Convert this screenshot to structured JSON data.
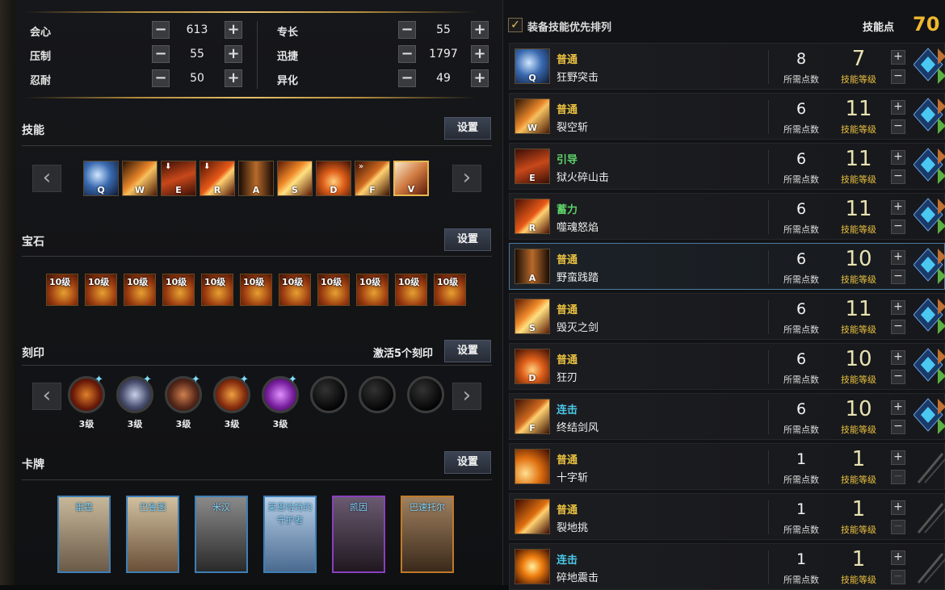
{
  "stats": {
    "left": [
      {
        "label": "会心",
        "value": "613"
      },
      {
        "label": "压制",
        "value": "55"
      },
      {
        "label": "忍耐",
        "value": "50"
      }
    ],
    "right": [
      {
        "label": "专长",
        "value": "55"
      },
      {
        "label": "迅捷",
        "value": "1797"
      },
      {
        "label": "异化",
        "value": "49"
      }
    ],
    "minus": "−",
    "plus": "+"
  },
  "sections": {
    "skills": "技能",
    "gems": "宝石",
    "engraving": "刻印",
    "cards": "卡牌",
    "settings_label": "设置",
    "engraving_note": "激活5个刻印"
  },
  "nav": {
    "prev": "‹",
    "next": "›"
  },
  "skill_bar": [
    {
      "key": "Q",
      "mark": ""
    },
    {
      "key": "W",
      "mark": ""
    },
    {
      "key": "E",
      "mark": "⬇"
    },
    {
      "key": "R",
      "mark": "⬇"
    },
    {
      "key": "A",
      "mark": ""
    },
    {
      "key": "S",
      "mark": ""
    },
    {
      "key": "D",
      "mark": ""
    },
    {
      "key": "F",
      "mark": "»"
    },
    {
      "key": "V",
      "mark": ""
    }
  ],
  "gems": {
    "label": "10级",
    "count": 11
  },
  "engravings": [
    {
      "level": "3级",
      "active": true
    },
    {
      "level": "3级",
      "active": true
    },
    {
      "level": "3级",
      "active": true
    },
    {
      "level": "3级",
      "active": true
    },
    {
      "level": "3级",
      "active": true
    },
    {
      "level": "",
      "active": false
    },
    {
      "level": "",
      "active": false
    },
    {
      "level": "",
      "active": false
    }
  ],
  "cards": [
    {
      "name": "雷霆",
      "border": "#3f7fb5"
    },
    {
      "name": "巴鲁图",
      "border": "#3f7fb5"
    },
    {
      "name": "米汉",
      "border": "#3f7fb5"
    },
    {
      "name": "莱恩哈特的守护者",
      "border": "#3f7fb5"
    },
    {
      "name": "凯因",
      "border": "#8a3fc0"
    },
    {
      "name": "巴速托尔",
      "border": "#c07a2a"
    }
  ],
  "right_panel": {
    "prioritize_label": "装备技能优先排列",
    "prioritize_checked": "✓",
    "points_label": "技能点",
    "points_value": "70 /",
    "cost_label": "所需点数",
    "level_label": "技能等级"
  },
  "skills": [
    {
      "key": "Q",
      "type": "普通",
      "type_color": "#e8c040",
      "name": "狂野突击",
      "cost": "8",
      "level": "7",
      "selected": false
    },
    {
      "key": "W",
      "type": "普通",
      "type_color": "#e8c040",
      "name": "裂空斩",
      "cost": "6",
      "level": "11",
      "selected": false
    },
    {
      "key": "E",
      "type": "引导",
      "type_color": "#5ed36a",
      "name": "狱火碎山击",
      "cost": "6",
      "level": "11",
      "selected": false
    },
    {
      "key": "R",
      "type": "蓄力",
      "type_color": "#5ed36a",
      "name": "噬魂怒焰",
      "cost": "6",
      "level": "11",
      "selected": false
    },
    {
      "key": "A",
      "type": "普通",
      "type_color": "#e8c040",
      "name": "野蛮践踏",
      "cost": "6",
      "level": "10",
      "selected": true
    },
    {
      "key": "S",
      "type": "普通",
      "type_color": "#e8c040",
      "name": "毁灭之剑",
      "cost": "6",
      "level": "11",
      "selected": false
    },
    {
      "key": "D",
      "type": "普通",
      "type_color": "#e8c040",
      "name": "狂刃",
      "cost": "6",
      "level": "10",
      "selected": false
    },
    {
      "key": "F",
      "type": "连击",
      "type_color": "#4ac8e8",
      "name": "终结剑风",
      "cost": "6",
      "level": "10",
      "selected": false
    },
    {
      "key": "",
      "type": "普通",
      "type_color": "#e8c040",
      "name": "十字斩",
      "cost": "1",
      "level": "1",
      "selected": false
    },
    {
      "key": "",
      "type": "普通",
      "type_color": "#e8c040",
      "name": "裂地挑",
      "cost": "1",
      "level": "1",
      "selected": false
    },
    {
      "key": "",
      "type": "连击",
      "type_color": "#4ac8e8",
      "name": "碎地震击",
      "cost": "1",
      "level": "1",
      "selected": false
    }
  ]
}
